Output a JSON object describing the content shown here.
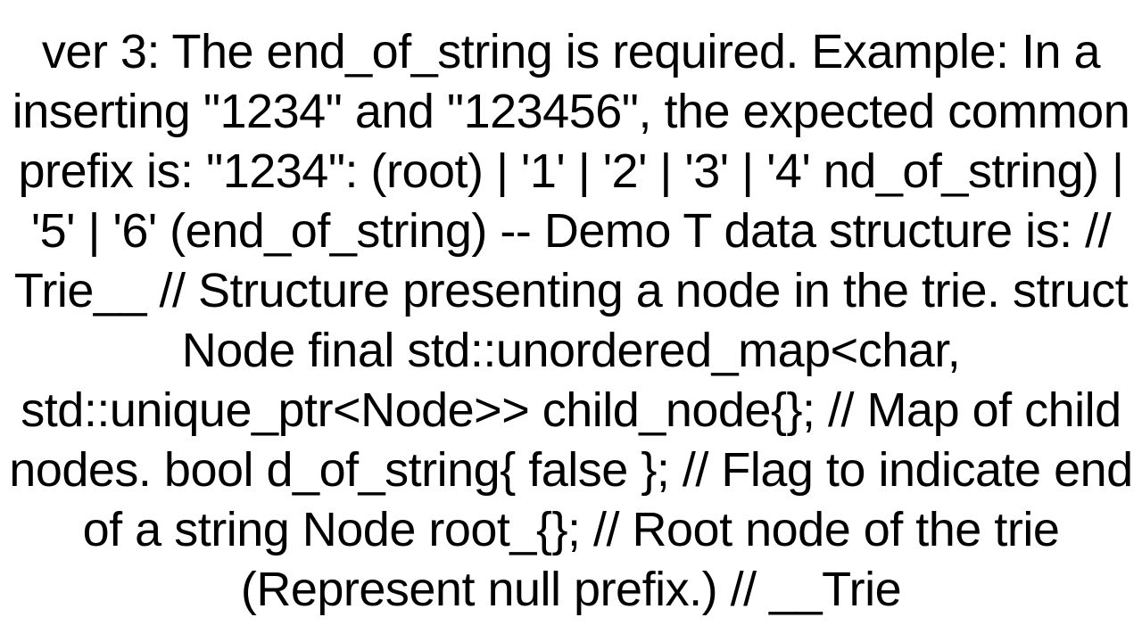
{
  "document": {
    "text": "ver 3: The end_of_string is required. Example: In a inserting \"1234\" and \"123456\", the expected common prefix is: \"1234\": (root)  |  '1'  |  '2'  |  '3'  |  '4' nd_of_string)  |  '5'  |  '6' (end_of_string)  -- Demo T data structure is:     // Trie__       // Structure presenting a node in the trie.     struct Node final std::unordered_map<char, std::unique_ptr<Node>> child_node{}; // Map of child nodes.        bool d_of_string{ false }; // Flag to indicate end of a string Node root_{}; // Root node of the trie (Represent null prefix.)      // __Trie"
  }
}
